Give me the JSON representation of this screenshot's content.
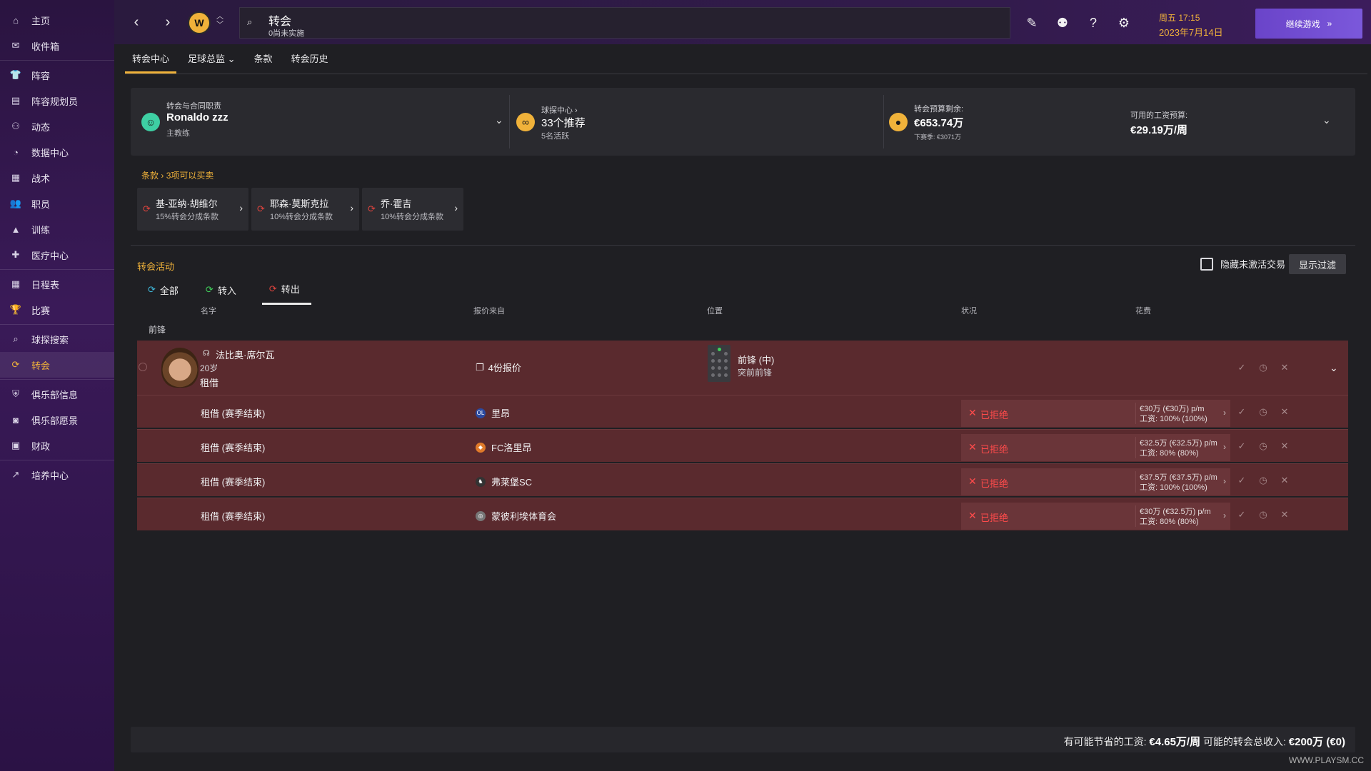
{
  "sidebar": {
    "items": [
      {
        "label": "主页",
        "icon": "home-icon"
      },
      {
        "label": "收件箱",
        "icon": "inbox-icon"
      },
      {
        "label": "阵容",
        "icon": "shirt-icon"
      },
      {
        "label": "阵容规划员",
        "icon": "clipboard-icon"
      },
      {
        "label": "动态",
        "icon": "dynamics-icon"
      },
      {
        "label": "数据中心",
        "icon": "data-icon"
      },
      {
        "label": "战术",
        "icon": "tactics-icon"
      },
      {
        "label": "职员",
        "icon": "staff-icon"
      },
      {
        "label": "训练",
        "icon": "training-icon"
      },
      {
        "label": "医疗中心",
        "icon": "medical-icon"
      },
      {
        "label": "日程表",
        "icon": "calendar-icon"
      },
      {
        "label": "比赛",
        "icon": "trophy-icon"
      },
      {
        "label": "球探搜索",
        "icon": "search-icon"
      },
      {
        "label": "转会",
        "icon": "transfer-icon"
      },
      {
        "label": "俱乐部信息",
        "icon": "shield-icon"
      },
      {
        "label": "俱乐部愿景",
        "icon": "vision-icon"
      },
      {
        "label": "财政",
        "icon": "finance-icon"
      },
      {
        "label": "培养中心",
        "icon": "development-icon"
      }
    ]
  },
  "topbar": {
    "search_title": "转会",
    "search_sub": "0尚未实施",
    "date_day": "周五 17:15",
    "date_date": "2023年7月14日",
    "continue_label": "继续游戏"
  },
  "tabs": [
    {
      "label": "转会中心"
    },
    {
      "label": "足球总监 ⌄"
    },
    {
      "label": "条款"
    },
    {
      "label": "转会历史"
    }
  ],
  "summary": {
    "staff_label": "转会与合同职责",
    "staff_name": "Ronaldo zzz",
    "staff_role": "主教练",
    "scout_label": "球探中心 ›",
    "scout_value": "33个推荐",
    "scout_sub": "5名活跃",
    "budget_label": "转会预算剩余:",
    "budget_value": "€653.74万",
    "budget_sub": "下赛季: €3071万",
    "wage_label": "可用的工资预算:",
    "wage_value": "€29.19万/周"
  },
  "clauses": {
    "crumb": "条款",
    "count": "3项可以买卖",
    "items": [
      {
        "name": "基-亚纳·胡维尔",
        "desc": "15%转会分成条款"
      },
      {
        "name": "耶森·莫斯克拉",
        "desc": "10%转会分成条款"
      },
      {
        "name": "乔·霍吉",
        "desc": "10%转会分成条款"
      }
    ]
  },
  "activity": {
    "title": "转会活动",
    "hide_label": "隐藏未激活交易",
    "filter_label": "显示过滤",
    "sub_tabs": [
      {
        "label": "全部"
      },
      {
        "label": "转入"
      },
      {
        "label": "转出"
      }
    ],
    "columns": {
      "name": "名字",
      "offer_from": "报价来自",
      "position": "位置",
      "status": "状况",
      "cost": "花费"
    },
    "group": "前锋",
    "player": {
      "name": "法比奥·席尔瓦",
      "age": "20岁",
      "status": "租借",
      "offers": "4份报价",
      "pos_main": "前锋 (中)",
      "pos_sub": "突前前锋"
    },
    "offers": [
      {
        "type": "租借 (赛季结束)",
        "club": "里昂",
        "status": "已拒绝",
        "fee": "€30万 (€30万) p/m",
        "wage": "工资: 100% (100%)"
      },
      {
        "type": "租借 (赛季结束)",
        "club": "FC洛里昂",
        "status": "已拒绝",
        "fee": "€32.5万 (€32.5万) p/m",
        "wage": "工资: 80% (80%)"
      },
      {
        "type": "租借 (赛季结束)",
        "club": "弗莱堡SC",
        "status": "已拒绝",
        "fee": "€37.5万 (€37.5万) p/m",
        "wage": "工资: 100% (100%)"
      },
      {
        "type": "租借 (赛季结束)",
        "club": "蒙彼利埃体育会",
        "status": "已拒绝",
        "fee": "€30万 (€32.5万) p/m",
        "wage": "工资: 80% (80%)"
      }
    ]
  },
  "footer": {
    "wage_save_label": "有可能节省的工资:",
    "wage_save_value": "€4.65万/周",
    "income_label": "可能的转会总收入:",
    "income_value": "€200万 (€0)"
  },
  "watermark": "WWW.PLAYSM.CC",
  "colors": {
    "accent": "#f0b23a",
    "reject": "#ff4b4b",
    "row_bg": "#5a2a2e",
    "continue": "#6a44c9"
  }
}
